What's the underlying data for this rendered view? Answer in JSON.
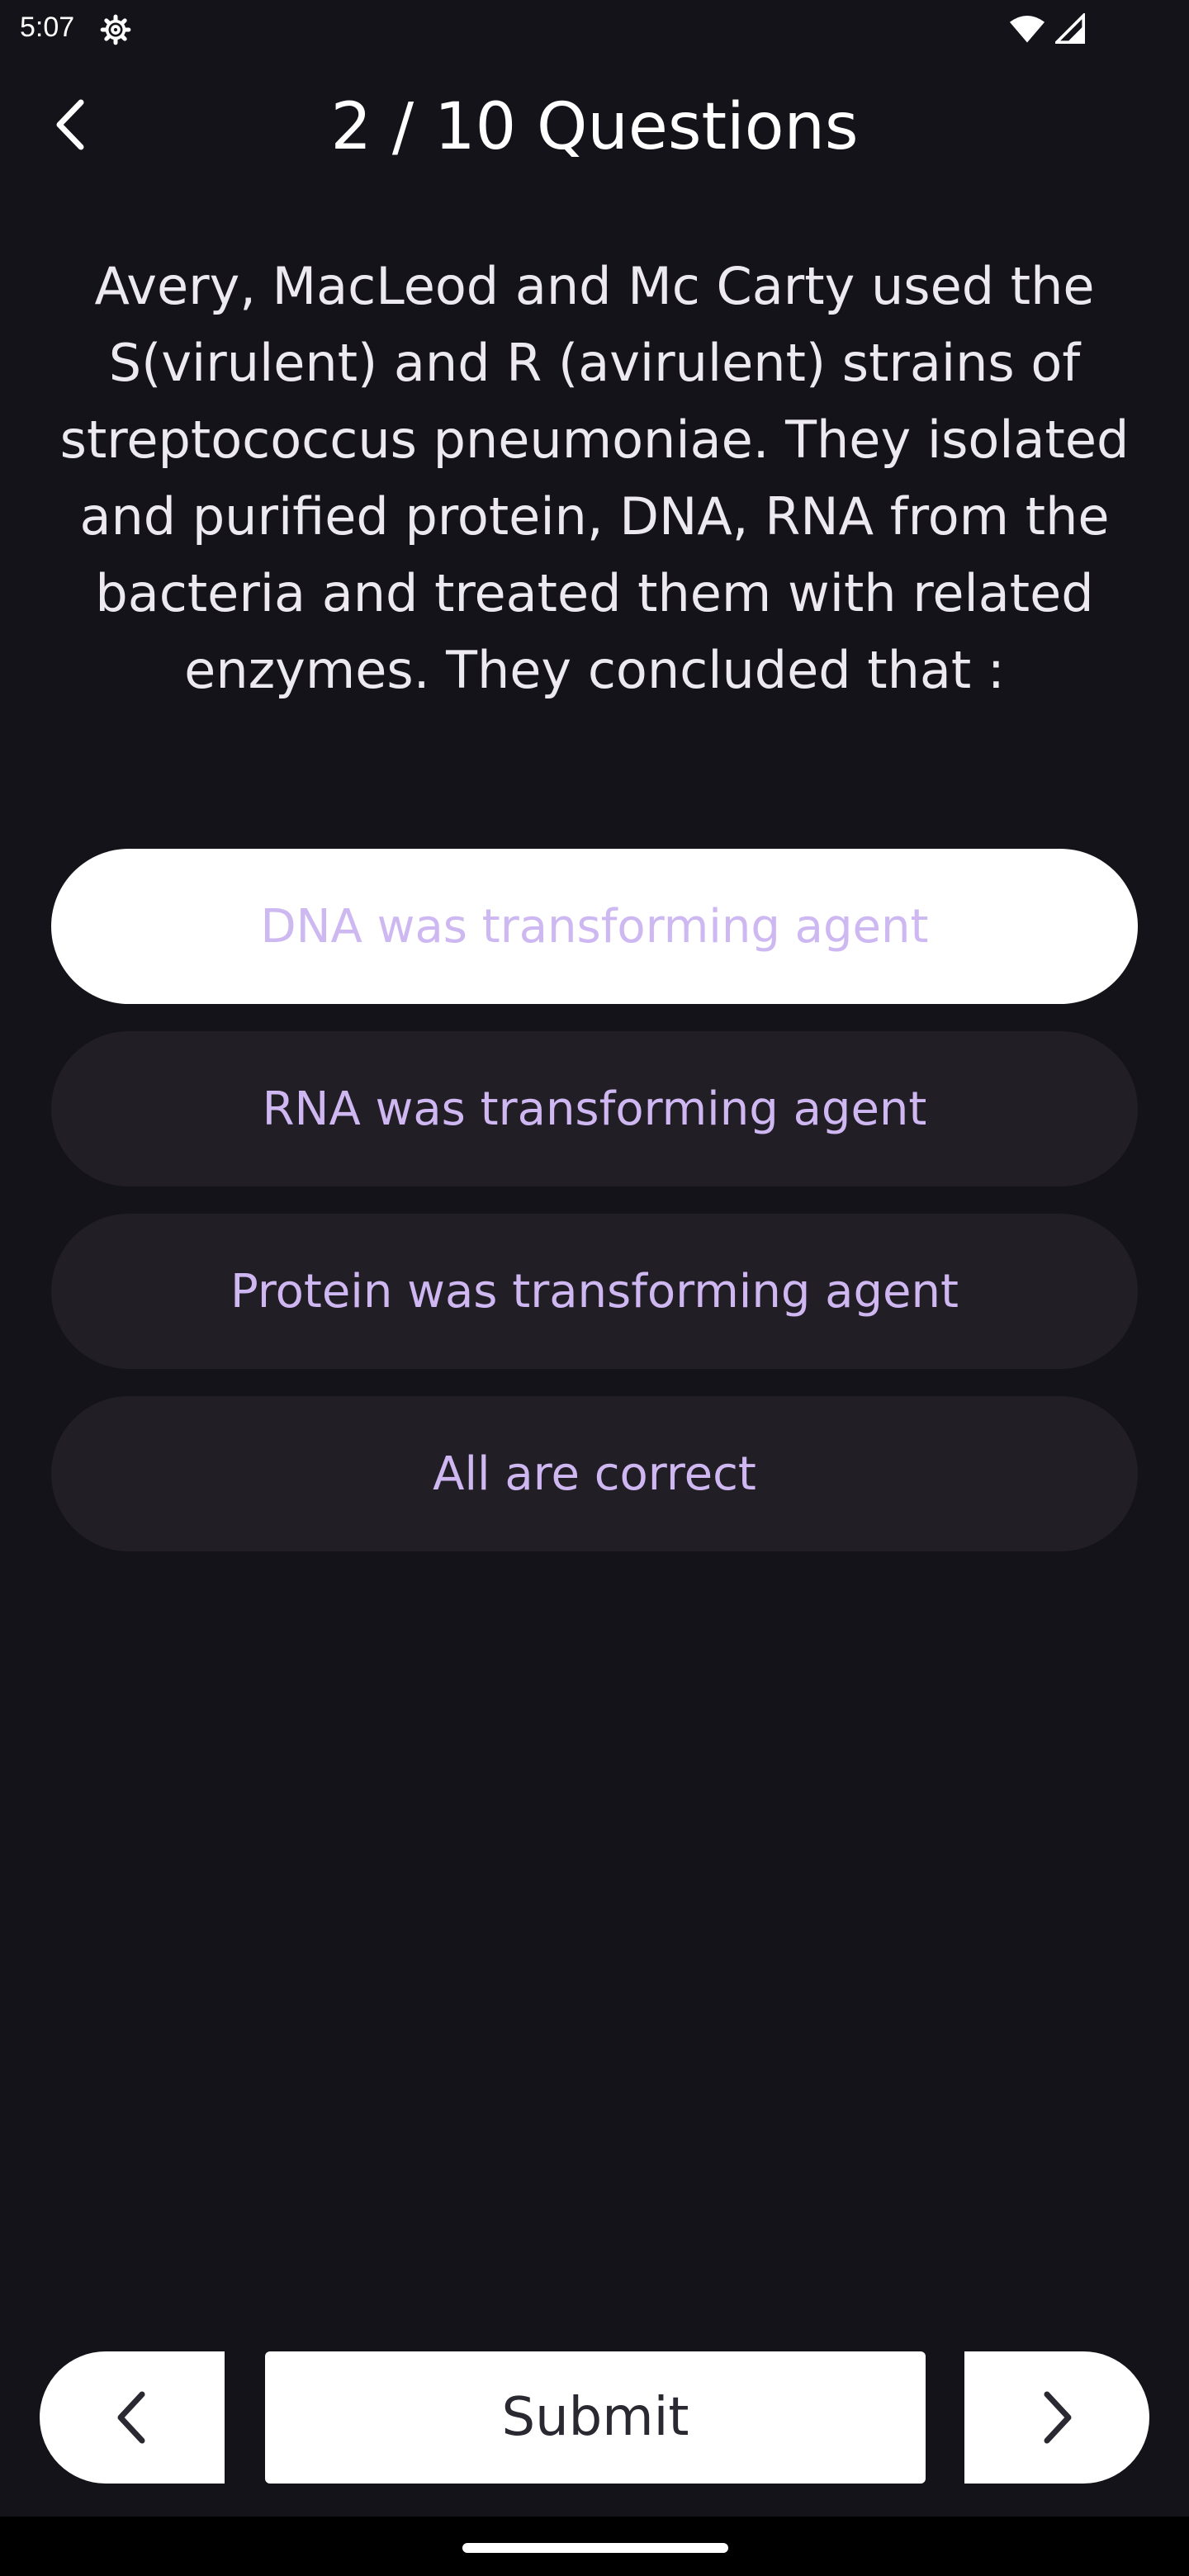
{
  "status_bar": {
    "time": "5:07",
    "icons": [
      "gear-icon",
      "wifi-icon",
      "signal-icon"
    ]
  },
  "header": {
    "title": "2 / 10 Questions",
    "back_icon": "chevron-left-icon"
  },
  "question": {
    "text": "Avery, MacLeod and Mc Carty used the S(virulent) and R (avirulent) strains of streptococcus pneumoniae. They isolated and purified protein, DNA, RNA from the bacteria and treated them with related enzymes. They concluded that :"
  },
  "options": [
    {
      "label": "DNA was transforming agent",
      "selected": true
    },
    {
      "label": "RNA was transforming agent",
      "selected": false
    },
    {
      "label": "Protein was transforming agent",
      "selected": false
    },
    {
      "label": "All are correct",
      "selected": false
    }
  ],
  "bottom_nav": {
    "submit_label": "Submit",
    "prev_icon": "chevron-left-icon",
    "next_icon": "chevron-right-icon"
  },
  "colors": {
    "background": "#15131a",
    "option_bg": "#211f25",
    "option_text": "#cfb7f2",
    "selected_bg": "#ffffff"
  }
}
